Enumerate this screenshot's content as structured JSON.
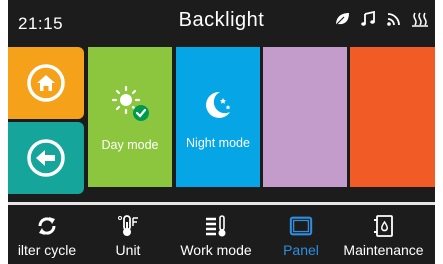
{
  "header": {
    "time": "21:15",
    "title": "Backlight",
    "status_icons": [
      "leaf-icon",
      "music-icon",
      "signal-icon",
      "heater-icon"
    ]
  },
  "sidebar": {
    "home_icon": "home-icon",
    "back_icon": "back-arrow-icon"
  },
  "tiles": [
    {
      "label": "Day mode",
      "icon": "sun-icon",
      "color": "#8cc63f",
      "selected": true
    },
    {
      "label": "Night mode",
      "icon": "moon-stars-icon",
      "color": "#06a5e6",
      "selected": false
    },
    {
      "label": "",
      "color": "#c39ccc"
    },
    {
      "label": "",
      "color": "#f05b26"
    }
  ],
  "nav": {
    "items": [
      {
        "label": "ilter cycle",
        "icon": "cycle-icon",
        "active": false
      },
      {
        "label": "Unit",
        "icon": "thermometer-icon",
        "active": false
      },
      {
        "label": "Work mode",
        "icon": "work-mode-icon",
        "active": false
      },
      {
        "label": "Panel",
        "icon": "panel-icon",
        "active": true
      },
      {
        "label": "Maintenance",
        "icon": "maintenance-icon",
        "active": false
      }
    ],
    "active_color": "#2e8fe0"
  }
}
